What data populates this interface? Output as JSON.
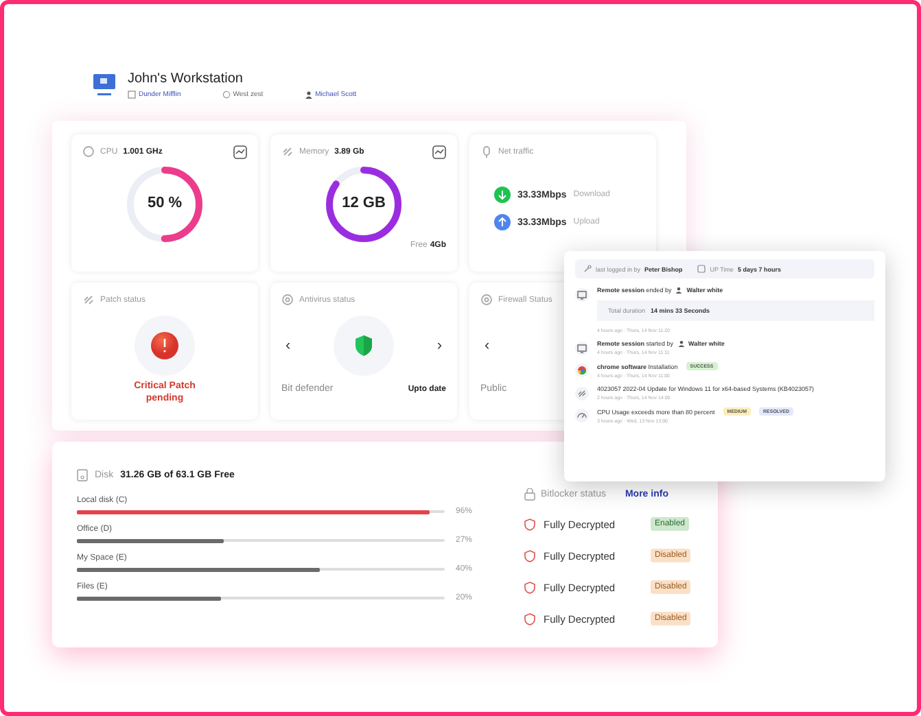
{
  "header": {
    "title": "John's Workstation",
    "company": "Dunder Mifflin",
    "location": "West zest",
    "user": "Michael Scott"
  },
  "metrics": [
    {
      "kind": "ring",
      "label": "CPU",
      "value": "1.001 GHz",
      "center": "50 %",
      "level": 0.5,
      "color": "#ec3d8c"
    },
    {
      "kind": "ring",
      "label": "Memory",
      "value": "3.89 Gb",
      "center": "12 GB",
      "level": 0.85,
      "color": "#9b2de0",
      "free_label": "Free",
      "free_value": "4Gb"
    },
    {
      "kind": "traffic",
      "label": "Net traffic",
      "download": "33.33Mbps",
      "download_label": "Download",
      "upload": "33.33Mbps",
      "upload_label": "Upload"
    }
  ],
  "status_cards": [
    {
      "kind": "patch",
      "label": "Patch status",
      "status": "Critical Patch pending"
    },
    {
      "kind": "antivirus",
      "label": "Antivirus status",
      "name": "Bit defender",
      "state": "Upto date",
      "prev": "‹",
      "next": "›"
    },
    {
      "kind": "firewall",
      "label": "Firewall Status",
      "name": "Public",
      "prev": "‹"
    }
  ],
  "activity": {
    "last_login_label": "last logged in by",
    "last_login_user": "Peter Bishop",
    "uptime_label": "UP Time",
    "uptime": "5 days 7 hours",
    "events": [
      {
        "kind": "session",
        "title": "**Remote session** ended by",
        "user": "Walter white",
        "detail_label": "Total duration",
        "detail_value": "14 mins 33 Seconds",
        "time": "4 hours ago · Thurs, 14 Nov 11:20"
      },
      {
        "kind": "session",
        "title": "**Remote session** started by",
        "user": "Walter white",
        "time": "4 hours ago · Thurs, 14 Nov 11:11"
      },
      {
        "kind": "app",
        "title": "**chrome software** Installation",
        "tags": [
          {
            "text": "SUCCESS",
            "color": "#d6f2d0"
          }
        ],
        "time": "4 hours ago · Thurs, 14 Nov 11:00"
      },
      {
        "kind": "patch",
        "title": "4023057 2022-04 Update for Windows 11 for x64-based Systems (KB4023057)",
        "time": "2 hours ago · Thurs, 14 Nov 14:00"
      },
      {
        "kind": "alert",
        "title": "CPU Usage exceeds more than 80 percent",
        "tags": [
          {
            "text": "MEDIUM",
            "color": "#fbeebb"
          },
          {
            "text": "RESOLVED",
            "color": "#e3e8fb"
          }
        ],
        "time": "3 hours ago · Wed, 13 Nov 13:00"
      }
    ]
  },
  "disk": {
    "label": "Disk",
    "summary": "31.26 GB of 63.1 GB Free",
    "drives": [
      {
        "name": "Local disk (C)",
        "level": 0.96,
        "percent": "96%",
        "color": "#e8414b"
      },
      {
        "name": "Office (D)",
        "level": 0.4,
        "percent": "27%",
        "color": "#6b6b6b"
      },
      {
        "name": "My Space (E)",
        "level": 0.66,
        "percent": "40%",
        "color": "#6b6b6b"
      },
      {
        "name": "Files (E)",
        "level": 0.39,
        "percent": "20%",
        "color": "#6b6b6b"
      }
    ]
  },
  "bitlocker": {
    "label": "Bitlocker status",
    "link": "More info",
    "rows": [
      {
        "text": "Fully Decrypted",
        "badge": "Enabled",
        "enabled": true
      },
      {
        "text": "Fully Decrypted",
        "badge": "Disabled",
        "enabled": false
      },
      {
        "text": "Fully Decrypted",
        "badge": "Disabled",
        "enabled": false
      },
      {
        "text": "Fully Decrypted",
        "badge": "Disabled",
        "enabled": false
      }
    ]
  }
}
